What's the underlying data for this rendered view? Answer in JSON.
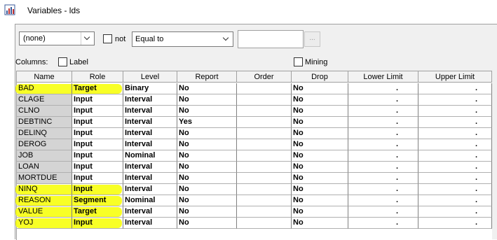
{
  "window": {
    "title": "Variables - lds"
  },
  "filter": {
    "role_value": "(none)",
    "not_label": "not",
    "operator_value": "Equal to",
    "value_text": "",
    "browse_label": "..."
  },
  "columns_section": {
    "label": "Columns:",
    "label_checkbox": "Label",
    "mining_checkbox": "Mining"
  },
  "table": {
    "headers": [
      "Name",
      "Role",
      "Level",
      "Report",
      "Order",
      "Drop",
      "Lower Limit",
      "Upper Limit"
    ],
    "rows": [
      {
        "name": "BAD",
        "role": "Target",
        "level": "Binary",
        "report": "No",
        "order": "",
        "drop": "No",
        "lower": ".",
        "upper": ".",
        "highlight": true
      },
      {
        "name": "CLAGE",
        "role": "Input",
        "level": "Interval",
        "report": "No",
        "order": "",
        "drop": "No",
        "lower": ".",
        "upper": ".",
        "highlight": false
      },
      {
        "name": "CLNO",
        "role": "Input",
        "level": "Interval",
        "report": "No",
        "order": "",
        "drop": "No",
        "lower": ".",
        "upper": ".",
        "highlight": false
      },
      {
        "name": "DEBTINC",
        "role": "Input",
        "level": "Interval",
        "report": "Yes",
        "order": "",
        "drop": "No",
        "lower": ".",
        "upper": ".",
        "highlight": false
      },
      {
        "name": "DELINQ",
        "role": "Input",
        "level": "Interval",
        "report": "No",
        "order": "",
        "drop": "No",
        "lower": ".",
        "upper": ".",
        "highlight": false
      },
      {
        "name": "DEROG",
        "role": "Input",
        "level": "Interval",
        "report": "No",
        "order": "",
        "drop": "No",
        "lower": ".",
        "upper": ".",
        "highlight": false
      },
      {
        "name": "JOB",
        "role": "Input",
        "level": "Nominal",
        "report": "No",
        "order": "",
        "drop": "No",
        "lower": ".",
        "upper": ".",
        "highlight": false
      },
      {
        "name": "LOAN",
        "role": "Input",
        "level": "Interval",
        "report": "No",
        "order": "",
        "drop": "No",
        "lower": ".",
        "upper": ".",
        "highlight": false
      },
      {
        "name": "MORTDUE",
        "role": "Input",
        "level": "Interval",
        "report": "No",
        "order": "",
        "drop": "No",
        "lower": ".",
        "upper": ".",
        "highlight": false
      },
      {
        "name": "NINQ",
        "role": "Input",
        "level": "Interval",
        "report": "No",
        "order": "",
        "drop": "No",
        "lower": ".",
        "upper": ".",
        "highlight": true
      },
      {
        "name": "REASON",
        "role": "Segment",
        "level": "Nominal",
        "report": "No",
        "order": "",
        "drop": "No",
        "lower": ".",
        "upper": ".",
        "highlight": true
      },
      {
        "name": "VALUE",
        "role": "Target",
        "level": "Interval",
        "report": "No",
        "order": "",
        "drop": "No",
        "lower": ".",
        "upper": ".",
        "highlight": true
      },
      {
        "name": "YOJ",
        "role": "Input",
        "level": "Interval",
        "report": "No",
        "order": "",
        "drop": "No",
        "lower": ".",
        "upper": ".",
        "highlight": true
      }
    ]
  },
  "colors": {
    "highlight": "#f7ff00",
    "name_column_bg": "#d4d4d4"
  }
}
